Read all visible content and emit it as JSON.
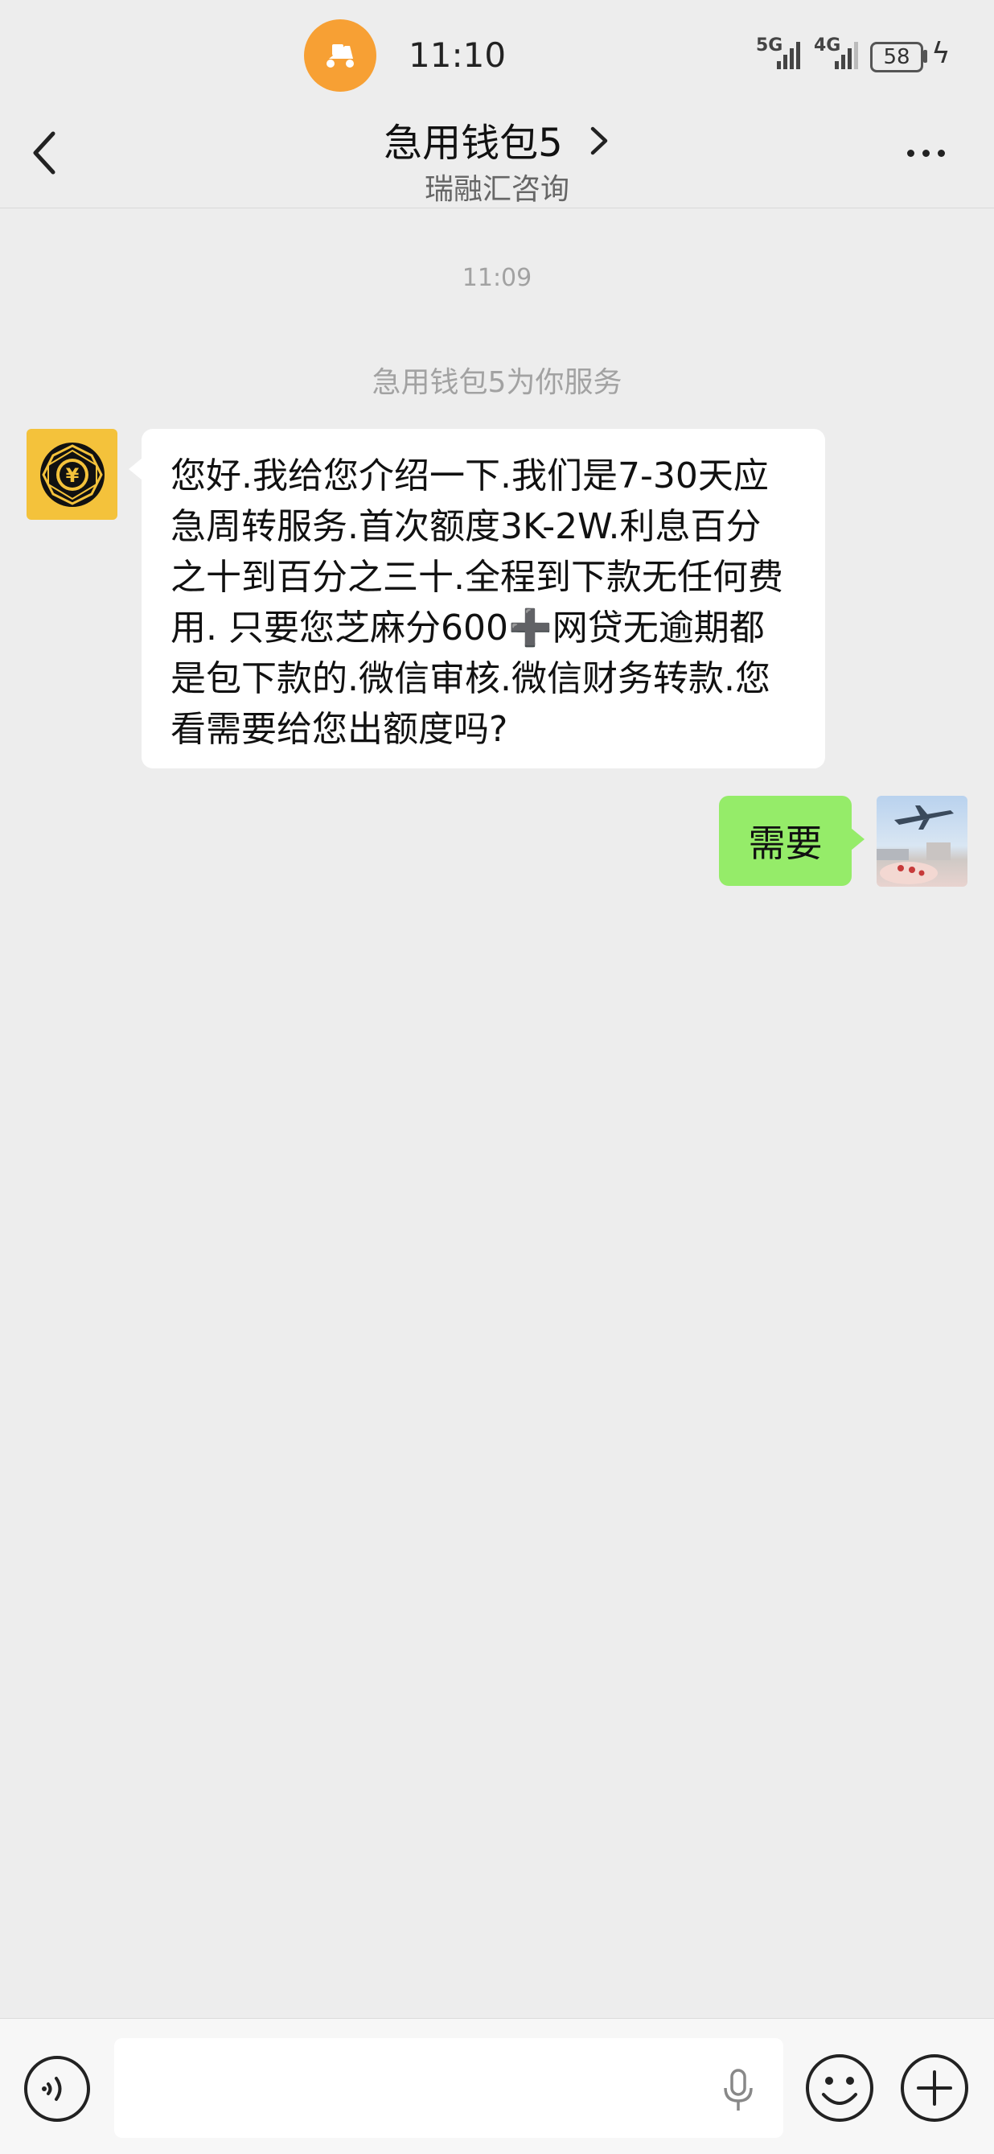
{
  "status_bar": {
    "time": "11:10",
    "network_1": "5G",
    "network_2": "4G",
    "battery": "58",
    "notification_icon": "scooter-icon"
  },
  "header": {
    "title": "急用钱包5",
    "subtitle": "瑞融汇咨询",
    "back_icon": "chevron-left-icon",
    "title_arrow_icon": "chevron-right-icon",
    "more_icon": "more-dots-icon"
  },
  "chat": {
    "timestamp": "11:09",
    "system_message": "急用钱包5为你服务",
    "incoming": {
      "text": "您好.我给您介绍一下.我们是7-30天应急周转服务.首次额度3K-2W.利息百分之十到百分之三十.全程到下款无任何费用. 只要您芝麻分600➕网贷无逾期都是包下款的.微信审核.微信财务转款.您看需要给您出额度吗?",
      "avatar_icon": "yuan-coin-logo-icon"
    },
    "outgoing": {
      "text": "需要",
      "avatar_icon": "airplane-photo-avatar"
    }
  },
  "input_bar": {
    "voice_icon": "voice-mode-icon",
    "input_value": "",
    "mic_icon": "microphone-icon",
    "emoji_icon": "emoji-icon",
    "plus_icon": "plus-icon"
  },
  "colors": {
    "background": "#ededed",
    "outgoing_bubble": "#95ec69",
    "incoming_bubble": "#ffffff",
    "notification": "#f7a034",
    "bot_avatar": "#f4c23b"
  }
}
